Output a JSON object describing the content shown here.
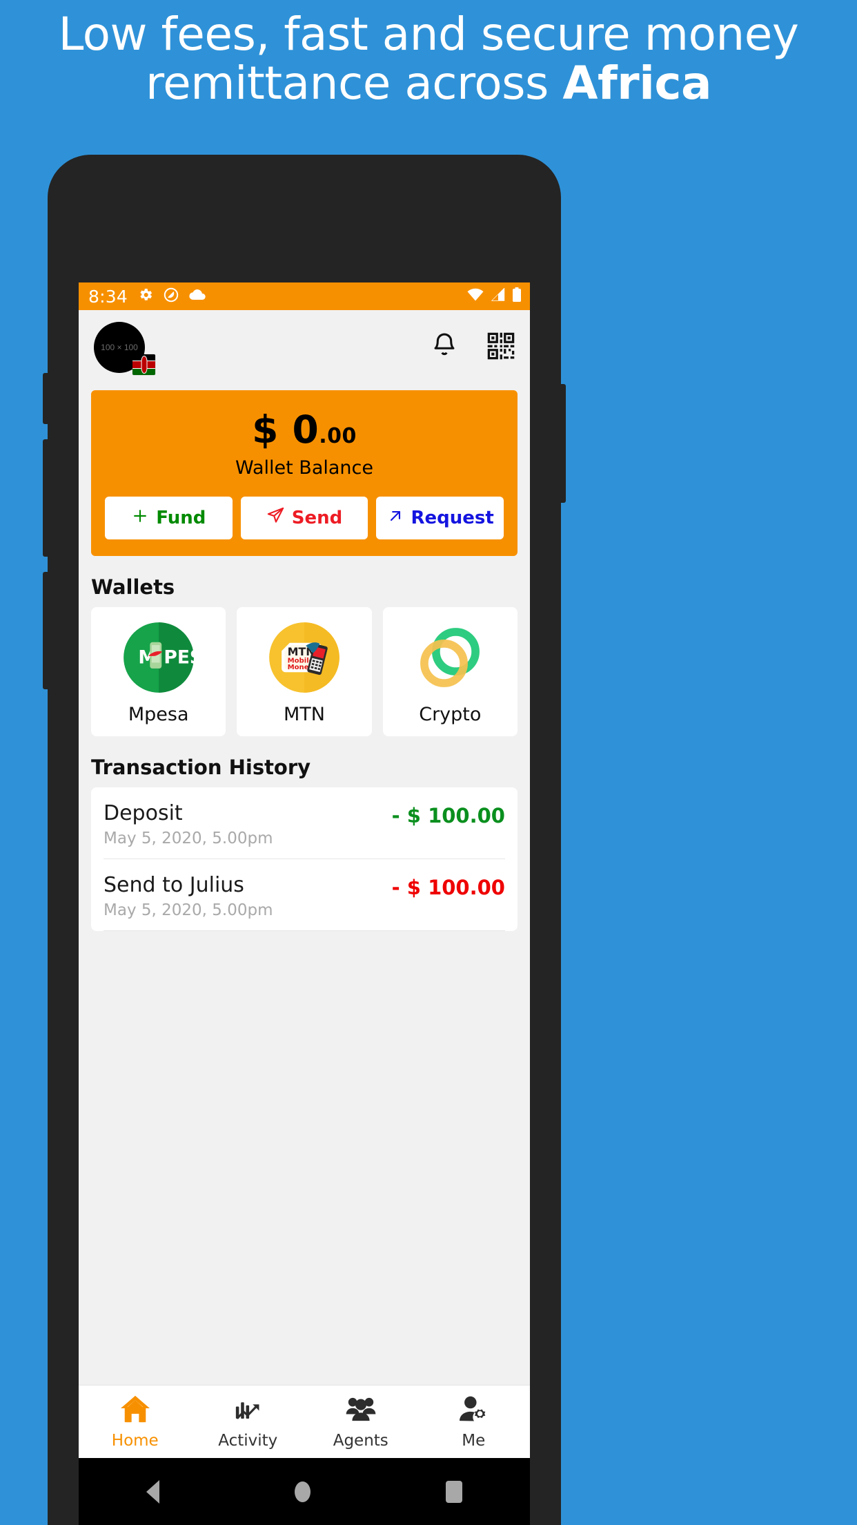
{
  "promo": {
    "line1": "Low fees, fast and secure money",
    "line2_prefix": "remittance across ",
    "line2_bold": "Africa",
    "bg_color": "#2f92d8"
  },
  "status_bar": {
    "time": "8:34",
    "left_icons": [
      "gear-icon",
      "do-not-disturb-icon",
      "cloud-icon"
    ],
    "right_icons": [
      "wifi-icon",
      "signal-icon",
      "battery-icon"
    ],
    "bg_color": "#f79000"
  },
  "app_bar": {
    "avatar_placeholder": "100 × 100",
    "flag": "kenya-flag",
    "notification_icon": "bell-icon",
    "qr_icon": "qr-code-icon"
  },
  "balance_card": {
    "currency": "$",
    "whole": "0",
    "cents": ".00",
    "label": "Wallet Balance",
    "bg_color": "#f79000",
    "actions": [
      {
        "id": "fund",
        "label": "Fund",
        "icon": "plus-icon",
        "color": "#008a00"
      },
      {
        "id": "send",
        "label": "Send",
        "icon": "paper-plane-icon",
        "color": "#ed1c24"
      },
      {
        "id": "request",
        "label": "Request",
        "icon": "arrow-up-right-icon",
        "color": "#1414e0"
      }
    ]
  },
  "wallets": {
    "title": "Wallets",
    "items": [
      {
        "id": "mpesa",
        "name": "Mpesa",
        "logo": "mpesa-logo",
        "color": "#1a9b46"
      },
      {
        "id": "mtn",
        "name": "MTN",
        "logo": "mtn-momo-logo",
        "color": "#f6bf2c"
      },
      {
        "id": "crypto",
        "name": "Crypto",
        "logo": "crypto-rings-logo",
        "color": "#2ecc80"
      }
    ]
  },
  "transactions": {
    "title": "Transaction History",
    "items": [
      {
        "title": "Deposit",
        "date": "May 5, 2020, 5.00pm",
        "amount": "- $ 100.00",
        "color": "#0a8f1e"
      },
      {
        "title": "Send to Julius",
        "date": "May 5, 2020, 5.00pm",
        "amount": "- $ 100.00",
        "color": "#ef0000"
      }
    ]
  },
  "bottom_nav": {
    "active": "home",
    "items": [
      {
        "id": "home",
        "label": "Home",
        "icon": "home-icon"
      },
      {
        "id": "activity",
        "label": "Activity",
        "icon": "activity-chart-icon"
      },
      {
        "id": "agents",
        "label": "Agents",
        "icon": "people-group-icon"
      },
      {
        "id": "me",
        "label": "Me",
        "icon": "person-gear-icon"
      }
    ]
  },
  "android_nav": {
    "back": "back-triangle-icon",
    "home": "home-circle-icon",
    "recents": "recents-square-icon"
  }
}
